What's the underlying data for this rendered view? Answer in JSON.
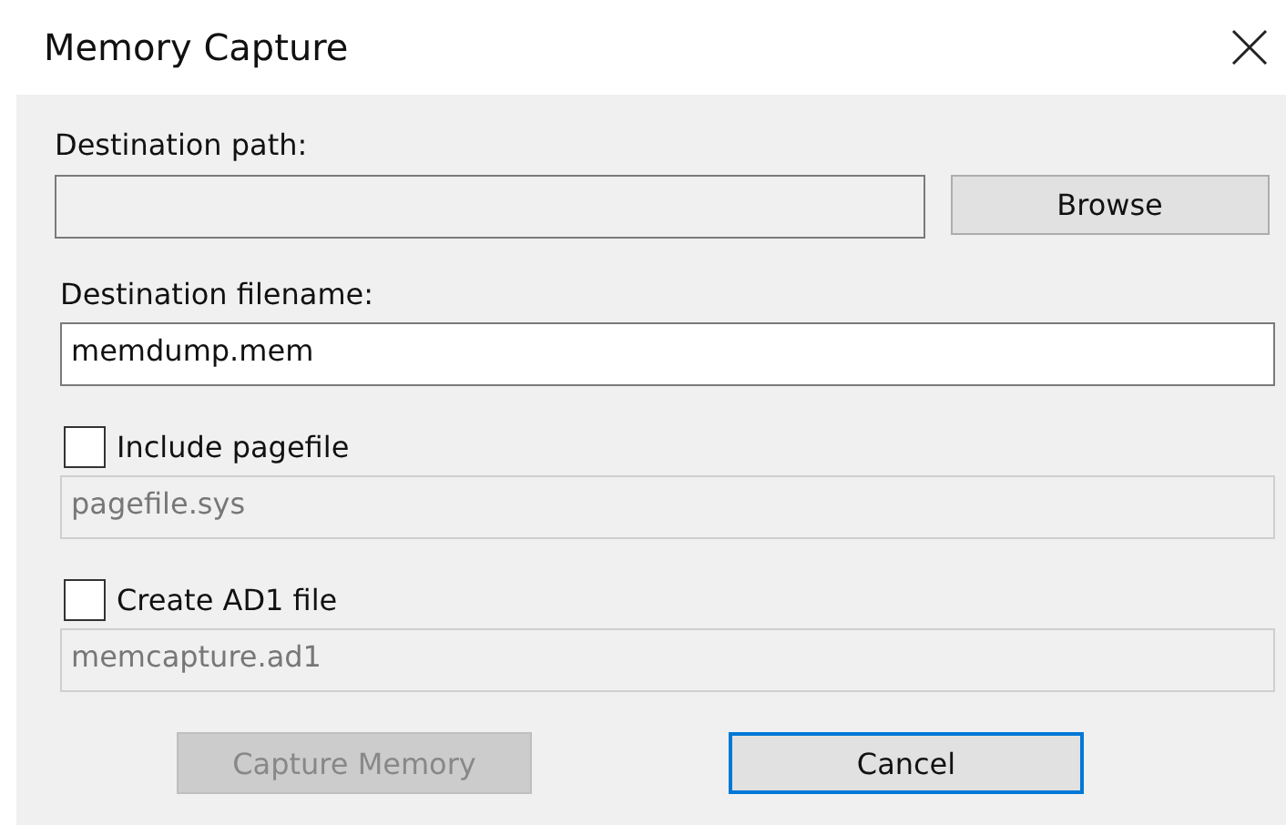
{
  "window": {
    "title": "Memory Capture"
  },
  "destination_path": {
    "label": "Destination path:",
    "browse_button": "Browse"
  },
  "destination_filename": {
    "label": "Destination filename:",
    "value": "memdump.mem",
    "disabled": false
  },
  "options": [
    {
      "label": "Include pagefile",
      "checked": false,
      "value": "pagefile.sys",
      "disabled": true
    },
    {
      "label": "Create AD1 file",
      "checked": false,
      "value": "memcapture.ad1",
      "disabled": true
    }
  ],
  "buttons": [
    {
      "label": "Capture Memory",
      "disabled": true,
      "default": false
    },
    {
      "label": "Cancel",
      "disabled": false,
      "default": true
    }
  ]
}
